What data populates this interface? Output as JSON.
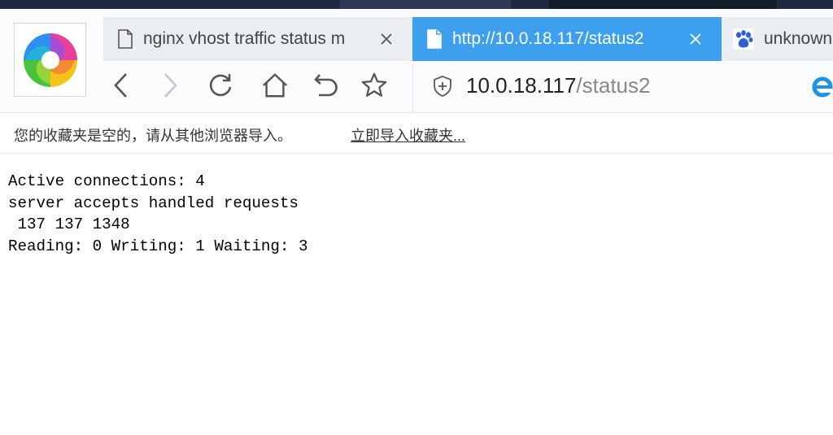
{
  "tabs": [
    {
      "title": "nginx vhost traffic status m",
      "active": false
    },
    {
      "title": "http://10.0.18.117/status2",
      "active": true
    },
    {
      "title": "unknown",
      "active": false
    }
  ],
  "toolbar": {
    "back_icon": "chevron-left-icon",
    "forward_icon": "chevron-right-icon",
    "reload_icon": "reload-icon",
    "home_icon": "home-icon",
    "undo_icon": "undo-icon",
    "favorite_icon": "star-icon"
  },
  "address": {
    "host": "10.0.18.117",
    "path": "/status2"
  },
  "bookmarks_bar": {
    "message": "您的收藏夹是空的，请从其他浏览器导入。",
    "import_link": "立即导入收藏夹..."
  },
  "status_page": {
    "line1": "Active connections: 4",
    "line2": "server accepts handled requests",
    "line3": " 137 137 1348",
    "line4": "Reading: 0 Writing: 1 Waiting: 3"
  },
  "colors": {
    "active_tab": "#3ca0ee",
    "inactive_tab": "#eaedf1",
    "top_strip": "#1f2a3f"
  }
}
